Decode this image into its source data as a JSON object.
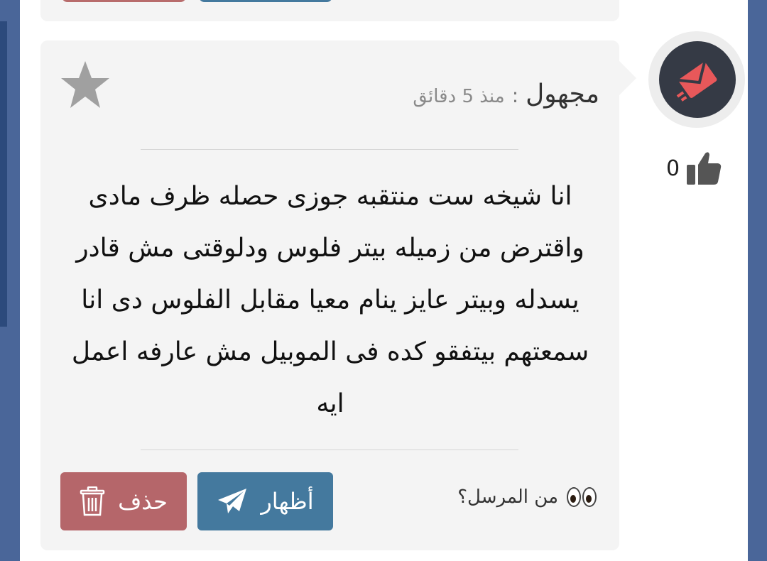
{
  "message_card": {
    "sender": "مجهول",
    "separator": ":",
    "time": "منذ 5 دقائق",
    "body": "انا شيخه ست منتقبه جوزى حصله ظرف مادى واقترض من زميله بيتر فلوس ودلوقتى مش قادر يسدله وبيتر عايز ينام معيا مقابل الفلوس دى انا سمعتهم بيتفقو كده فى الموبيل مش عارفه اعمل ايه",
    "likes": "0",
    "who_sent_label": "من المرسل؟",
    "reveal_button": "أظهار",
    "delete_button": "حذف"
  },
  "colors": {
    "reveal": "#44799e",
    "delete": "#b5666a",
    "card_bg": "#f4f4f4",
    "avatar_bg": "#353a45",
    "avatar_icon": "#e8585a"
  },
  "icons": {
    "favorite": "star-icon",
    "like": "thumbs-up-icon",
    "avatar": "envelope-icon",
    "reveal": "paper-plane-icon",
    "delete": "trash-icon",
    "who": "eyes-icon"
  }
}
